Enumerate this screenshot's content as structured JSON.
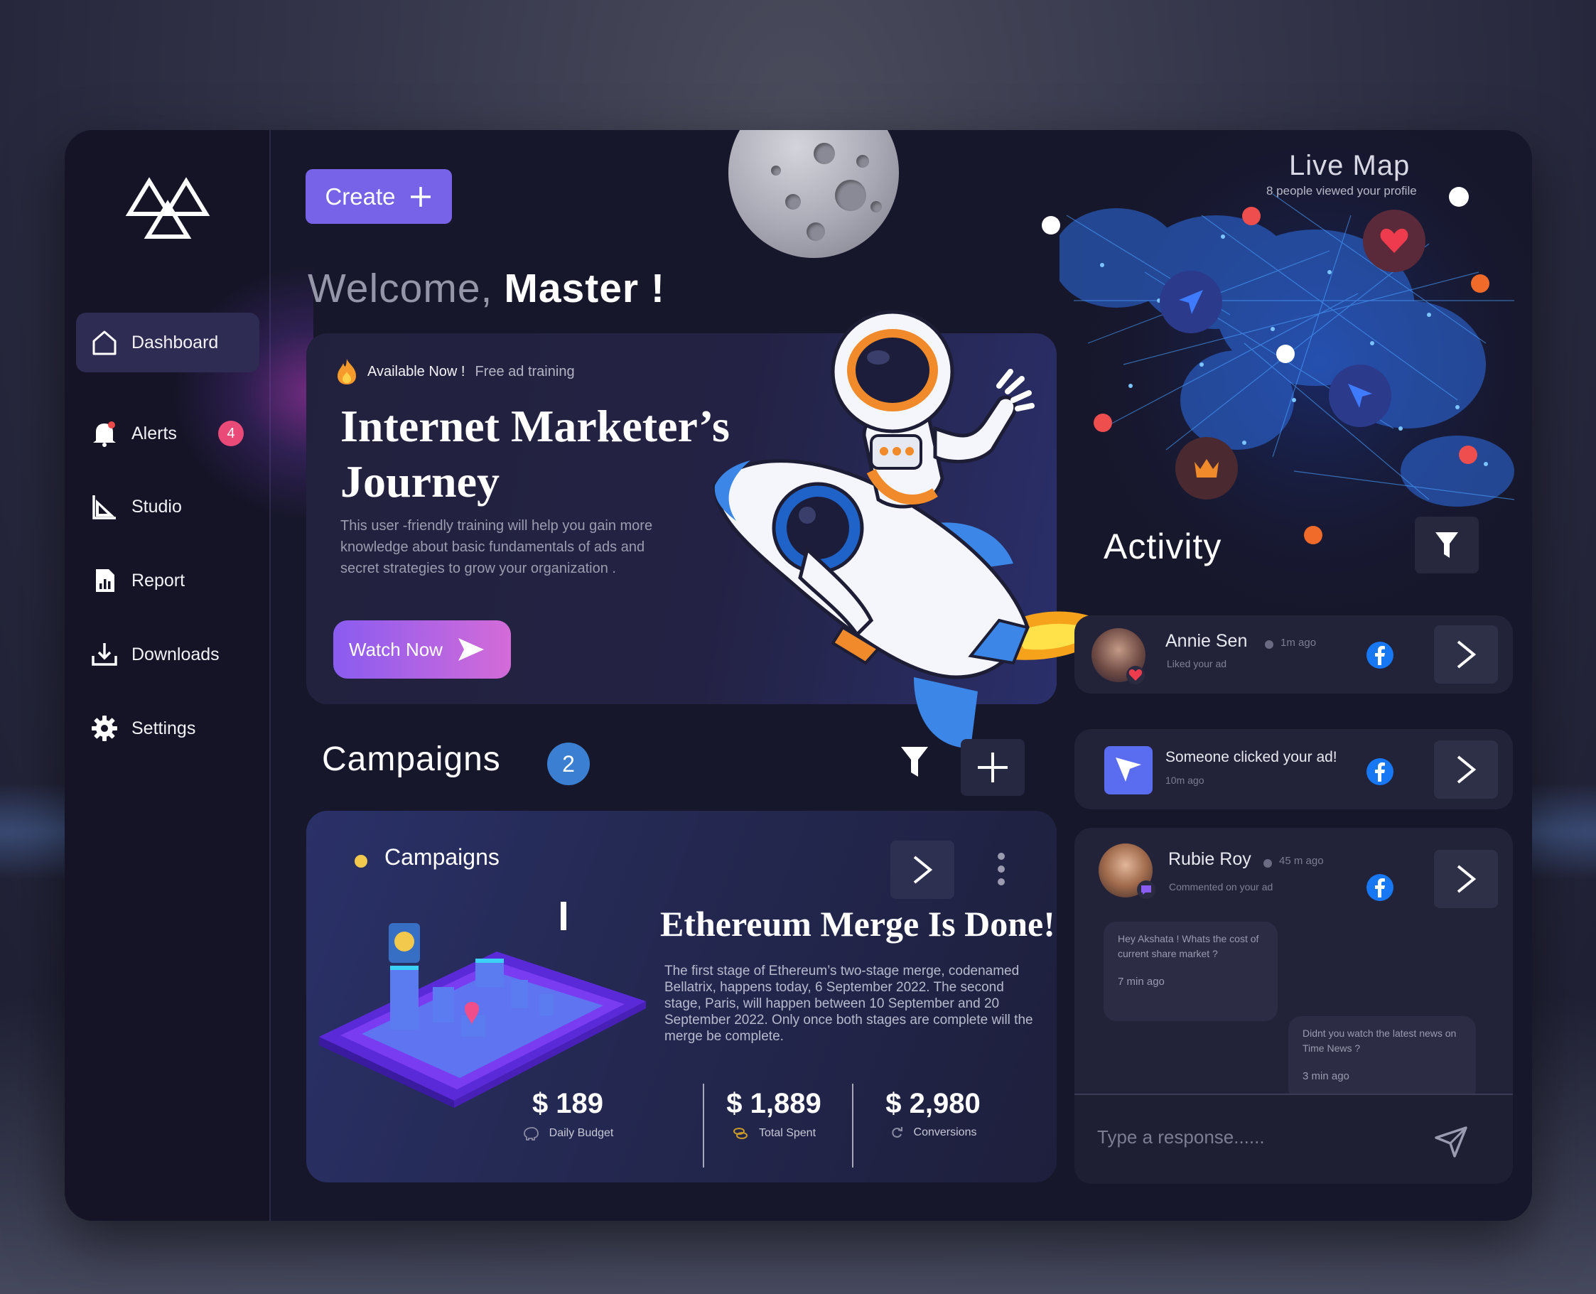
{
  "sidebar": {
    "items": [
      {
        "label": "Dashboard",
        "icon": "home-icon",
        "active": true
      },
      {
        "label": "Alerts",
        "icon": "bell-icon",
        "badge": "4"
      },
      {
        "label": "Studio",
        "icon": "studio-icon"
      },
      {
        "label": "Report",
        "icon": "report-icon"
      },
      {
        "label": "Downloads",
        "icon": "download-icon"
      },
      {
        "label": "Settings",
        "icon": "gear-icon"
      }
    ]
  },
  "header": {
    "create_label": "Create",
    "welcome": "Welcome,",
    "user": "Master !"
  },
  "hero": {
    "tag_available": "Available Now !",
    "tag_free": "Free ad training",
    "title": "Internet Marketer’s Journey",
    "description": "This user -friendly training will help you gain more knowledge about basic fundamentals of ads and secret strategies to grow your organization .",
    "watch_label": "Watch Now"
  },
  "campaigns": {
    "heading": "Campaigns",
    "count": "2",
    "card": {
      "label": "Campaigns",
      "title": "Ethereum Merge Is Done!",
      "description": "The first stage of Ethereum’s two-stage merge, codenamed Bellatrix, happens today, 6 September 2022. The second stage, Paris, will happen between 10 September and 20 September 2022. Only once both stages are complete will the merge be complete.",
      "stats": [
        {
          "value": "$ 189",
          "label": "Daily Budget"
        },
        {
          "value": "$ 1,889",
          "label": "Total Spent"
        },
        {
          "value": "$ 2,980",
          "label": "Conversions"
        }
      ]
    }
  },
  "live_map": {
    "title": "Live Map",
    "subtitle": "8 people viewed your profile"
  },
  "activity": {
    "title": "Activity",
    "items": [
      {
        "name": "Annie Sen",
        "time": "1m ago",
        "sub": "Liked your ad"
      },
      {
        "name": "Someone clicked your ad!",
        "time": "10m ago"
      },
      {
        "name": "Rubie Roy",
        "time": "45 m ago",
        "sub": "Commented on your ad"
      }
    ],
    "messages": [
      {
        "text": "Hey Akshata ! Whats the cost of current share market ?",
        "time": "7 min ago"
      },
      {
        "text": "Didnt you watch the latest news on Time News ?",
        "time": "3 min ago"
      }
    ],
    "reply_placeholder": "Type a  response......"
  },
  "colors": {
    "accent": "#7763e8",
    "badge": "#ea4a77",
    "count": "#3b7fd2",
    "facebook": "#1877f2"
  }
}
